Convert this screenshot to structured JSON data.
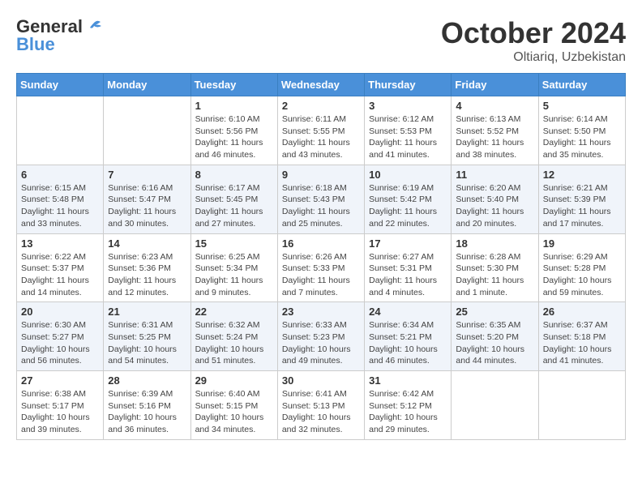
{
  "logo": {
    "line1": "General",
    "line2": "Blue"
  },
  "title": "October 2024",
  "location": "Oltiariq, Uzbekistan",
  "days_of_week": [
    "Sunday",
    "Monday",
    "Tuesday",
    "Wednesday",
    "Thursday",
    "Friday",
    "Saturday"
  ],
  "weeks": [
    [
      {
        "day": "",
        "info": ""
      },
      {
        "day": "",
        "info": ""
      },
      {
        "day": "1",
        "info": "Sunrise: 6:10 AM\nSunset: 5:56 PM\nDaylight: 11 hours and 46 minutes."
      },
      {
        "day": "2",
        "info": "Sunrise: 6:11 AM\nSunset: 5:55 PM\nDaylight: 11 hours and 43 minutes."
      },
      {
        "day": "3",
        "info": "Sunrise: 6:12 AM\nSunset: 5:53 PM\nDaylight: 11 hours and 41 minutes."
      },
      {
        "day": "4",
        "info": "Sunrise: 6:13 AM\nSunset: 5:52 PM\nDaylight: 11 hours and 38 minutes."
      },
      {
        "day": "5",
        "info": "Sunrise: 6:14 AM\nSunset: 5:50 PM\nDaylight: 11 hours and 35 minutes."
      }
    ],
    [
      {
        "day": "6",
        "info": "Sunrise: 6:15 AM\nSunset: 5:48 PM\nDaylight: 11 hours and 33 minutes."
      },
      {
        "day": "7",
        "info": "Sunrise: 6:16 AM\nSunset: 5:47 PM\nDaylight: 11 hours and 30 minutes."
      },
      {
        "day": "8",
        "info": "Sunrise: 6:17 AM\nSunset: 5:45 PM\nDaylight: 11 hours and 27 minutes."
      },
      {
        "day": "9",
        "info": "Sunrise: 6:18 AM\nSunset: 5:43 PM\nDaylight: 11 hours and 25 minutes."
      },
      {
        "day": "10",
        "info": "Sunrise: 6:19 AM\nSunset: 5:42 PM\nDaylight: 11 hours and 22 minutes."
      },
      {
        "day": "11",
        "info": "Sunrise: 6:20 AM\nSunset: 5:40 PM\nDaylight: 11 hours and 20 minutes."
      },
      {
        "day": "12",
        "info": "Sunrise: 6:21 AM\nSunset: 5:39 PM\nDaylight: 11 hours and 17 minutes."
      }
    ],
    [
      {
        "day": "13",
        "info": "Sunrise: 6:22 AM\nSunset: 5:37 PM\nDaylight: 11 hours and 14 minutes."
      },
      {
        "day": "14",
        "info": "Sunrise: 6:23 AM\nSunset: 5:36 PM\nDaylight: 11 hours and 12 minutes."
      },
      {
        "day": "15",
        "info": "Sunrise: 6:25 AM\nSunset: 5:34 PM\nDaylight: 11 hours and 9 minutes."
      },
      {
        "day": "16",
        "info": "Sunrise: 6:26 AM\nSunset: 5:33 PM\nDaylight: 11 hours and 7 minutes."
      },
      {
        "day": "17",
        "info": "Sunrise: 6:27 AM\nSunset: 5:31 PM\nDaylight: 11 hours and 4 minutes."
      },
      {
        "day": "18",
        "info": "Sunrise: 6:28 AM\nSunset: 5:30 PM\nDaylight: 11 hours and 1 minute."
      },
      {
        "day": "19",
        "info": "Sunrise: 6:29 AM\nSunset: 5:28 PM\nDaylight: 10 hours and 59 minutes."
      }
    ],
    [
      {
        "day": "20",
        "info": "Sunrise: 6:30 AM\nSunset: 5:27 PM\nDaylight: 10 hours and 56 minutes."
      },
      {
        "day": "21",
        "info": "Sunrise: 6:31 AM\nSunset: 5:25 PM\nDaylight: 10 hours and 54 minutes."
      },
      {
        "day": "22",
        "info": "Sunrise: 6:32 AM\nSunset: 5:24 PM\nDaylight: 10 hours and 51 minutes."
      },
      {
        "day": "23",
        "info": "Sunrise: 6:33 AM\nSunset: 5:23 PM\nDaylight: 10 hours and 49 minutes."
      },
      {
        "day": "24",
        "info": "Sunrise: 6:34 AM\nSunset: 5:21 PM\nDaylight: 10 hours and 46 minutes."
      },
      {
        "day": "25",
        "info": "Sunrise: 6:35 AM\nSunset: 5:20 PM\nDaylight: 10 hours and 44 minutes."
      },
      {
        "day": "26",
        "info": "Sunrise: 6:37 AM\nSunset: 5:18 PM\nDaylight: 10 hours and 41 minutes."
      }
    ],
    [
      {
        "day": "27",
        "info": "Sunrise: 6:38 AM\nSunset: 5:17 PM\nDaylight: 10 hours and 39 minutes."
      },
      {
        "day": "28",
        "info": "Sunrise: 6:39 AM\nSunset: 5:16 PM\nDaylight: 10 hours and 36 minutes."
      },
      {
        "day": "29",
        "info": "Sunrise: 6:40 AM\nSunset: 5:15 PM\nDaylight: 10 hours and 34 minutes."
      },
      {
        "day": "30",
        "info": "Sunrise: 6:41 AM\nSunset: 5:13 PM\nDaylight: 10 hours and 32 minutes."
      },
      {
        "day": "31",
        "info": "Sunrise: 6:42 AM\nSunset: 5:12 PM\nDaylight: 10 hours and 29 minutes."
      },
      {
        "day": "",
        "info": ""
      },
      {
        "day": "",
        "info": ""
      }
    ]
  ]
}
